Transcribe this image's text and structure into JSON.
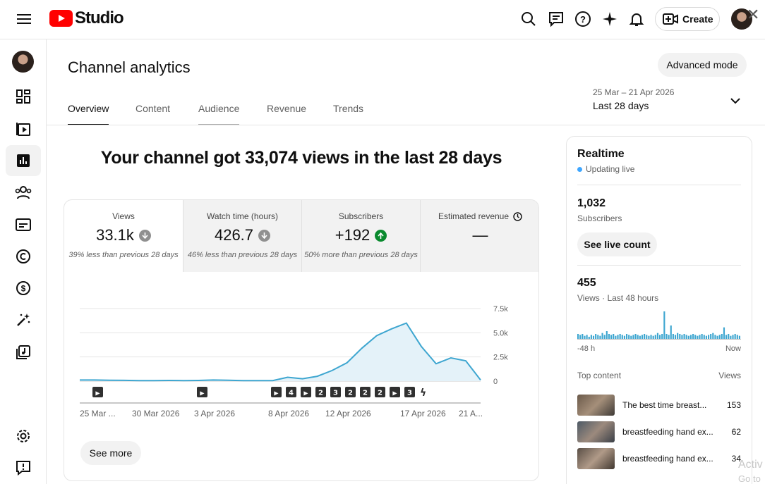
{
  "header": {
    "logo_text": "Studio",
    "create_label": "Create"
  },
  "page": {
    "title": "Channel analytics",
    "advanced_mode": "Advanced mode",
    "tabs": [
      {
        "label": "Overview"
      },
      {
        "label": "Content"
      },
      {
        "label": "Audience"
      },
      {
        "label": "Revenue"
      },
      {
        "label": "Trends"
      }
    ],
    "date_range": "25 Mar – 21 Apr 2026",
    "date_period": "Last 28 days",
    "headline": "Your channel got 33,074 views in the last 28 days"
  },
  "metrics": [
    {
      "label": "Views",
      "value": "33.1k",
      "trend": "down",
      "note": "39% less than previous 28 days"
    },
    {
      "label": "Watch time (hours)",
      "value": "426.7",
      "trend": "down",
      "note": "46% less than previous 28 days"
    },
    {
      "label": "Subscribers",
      "value": "+192",
      "trend": "up",
      "note": "50% more than previous 28 days"
    },
    {
      "label": "Estimated revenue",
      "value": "—",
      "trend": "none",
      "note": ""
    }
  ],
  "see_more": "See more",
  "chart_data": {
    "type": "area",
    "x": [
      "25 Mar",
      "26 Mar",
      "27 Mar",
      "28 Mar",
      "29 Mar",
      "30 Mar",
      "31 Mar",
      "1 Apr",
      "2 Apr",
      "3 Apr",
      "4 Apr",
      "5 Apr",
      "6 Apr",
      "7 Apr",
      "8 Apr",
      "9 Apr",
      "10 Apr",
      "11 Apr",
      "12 Apr",
      "13 Apr",
      "14 Apr",
      "15 Apr",
      "16 Apr",
      "17 Apr",
      "18 Apr",
      "19 Apr",
      "20 Apr",
      "21 Apr"
    ],
    "values": [
      120,
      120,
      90,
      80,
      60,
      60,
      70,
      60,
      70,
      120,
      90,
      60,
      60,
      60,
      400,
      250,
      500,
      1100,
      1900,
      3400,
      4700,
      5400,
      6000,
      3600,
      1800,
      2400,
      2100,
      120
    ],
    "x_tick_labels": [
      "25 Mar ...",
      "30 Mar 2026",
      "3 Apr 2026",
      "8 Apr 2026",
      "12 Apr 2026",
      "17 Apr 2026",
      "21 A..."
    ],
    "y_tick_labels": [
      "7.5k",
      "5.0k",
      "2.5k",
      "0"
    ],
    "ylim": [
      0,
      7500
    ],
    "grid": true,
    "color": "#3ea6d0",
    "markers": [
      "▶",
      "▶",
      "▶",
      "4",
      "▶",
      "2",
      "3",
      "2",
      "2",
      "2",
      "▶",
      "3",
      "shorts"
    ]
  },
  "realtime": {
    "title": "Realtime",
    "status": "Updating live",
    "subscribers": "1,032",
    "subscribers_label": "Subscribers",
    "live_count_button": "See live count",
    "views": "455",
    "views_label": "Views · Last 48 hours",
    "axis_start": "-48 h",
    "axis_end": "Now",
    "bars": [
      6,
      5,
      6,
      4,
      5,
      3,
      5,
      4,
      6,
      5,
      4,
      7,
      5,
      9,
      6,
      5,
      6,
      4,
      5,
      6,
      5,
      4,
      6,
      5,
      4,
      5,
      6,
      5,
      4,
      5,
      6,
      5,
      4,
      5,
      4,
      5,
      7,
      5,
      6,
      30,
      6,
      5,
      15,
      6,
      5,
      7,
      6,
      5,
      6,
      5,
      4,
      5,
      6,
      5,
      4,
      5,
      6,
      5,
      4,
      5,
      6,
      7,
      5,
      4,
      5,
      6,
      13,
      5,
      6,
      4,
      5,
      6,
      5,
      4
    ],
    "top_content_label": "Top content",
    "views_col_label": "Views",
    "top_content": [
      {
        "title": "The best time breast...",
        "views": "153"
      },
      {
        "title": "breastfeeding hand ex...",
        "views": "62"
      },
      {
        "title": "breastfeeding hand ex...",
        "views": "34"
      }
    ]
  },
  "watermark": {
    "line1": "Activ",
    "line2": "Go to"
  }
}
